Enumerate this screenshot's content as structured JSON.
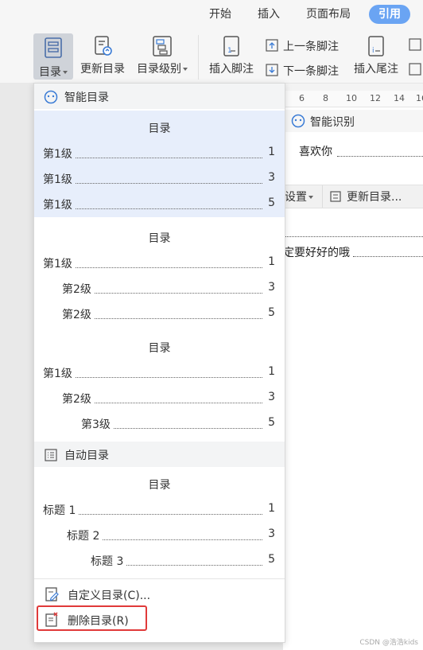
{
  "tabs": [
    "开始",
    "插入",
    "页面布局",
    "引用"
  ],
  "ribbon": {
    "toc": "目录",
    "update_toc": "更新目录",
    "toc_level": "目录级别",
    "insert_footnote": "插入脚注",
    "prev_footnote": "上一条脚注",
    "next_footnote": "下一条脚注",
    "insert_endnote": "插入尾注"
  },
  "ruler": [
    "6",
    "8",
    "10",
    "12",
    "14",
    "16"
  ],
  "doc": {
    "smart_identify": "智能识别",
    "line1": "喜欢你",
    "settings": "设置",
    "update_toc_btn": "更新目录...",
    "line2": "定要好好的哦"
  },
  "dropdown": {
    "smart_toc_header": "智能目录",
    "presets": [
      {
        "title": "目录",
        "entries": [
          {
            "label": "第1级",
            "page": "1"
          },
          {
            "label": "第1级",
            "page": "3"
          },
          {
            "label": "第1级",
            "page": "5"
          }
        ]
      },
      {
        "title": "目录",
        "entries": [
          {
            "label": "第1级",
            "page": "1"
          },
          {
            "label": "第2级",
            "page": "3"
          },
          {
            "label": "第2级",
            "page": "5"
          }
        ]
      },
      {
        "title": "目录",
        "entries": [
          {
            "label": "第1级",
            "page": "1"
          },
          {
            "label": "第2级",
            "page": "3"
          },
          {
            "label": "第3级",
            "page": "5"
          }
        ]
      }
    ],
    "auto_toc_header": "自动目录",
    "auto_preset": {
      "title": "目录",
      "entries": [
        {
          "label": "标题 1",
          "page": "1"
        },
        {
          "label": "标题 2",
          "page": "3"
        },
        {
          "label": "标题 3",
          "page": "5"
        }
      ]
    },
    "custom_toc": "自定义目录(C)...",
    "delete_toc": "删除目录(R)"
  },
  "watermark": "CSDN @浩浩kids",
  "colors": {
    "accent": "#6aa4f3",
    "highlight": "#e7eefb",
    "red_box": "#e03a3a"
  }
}
